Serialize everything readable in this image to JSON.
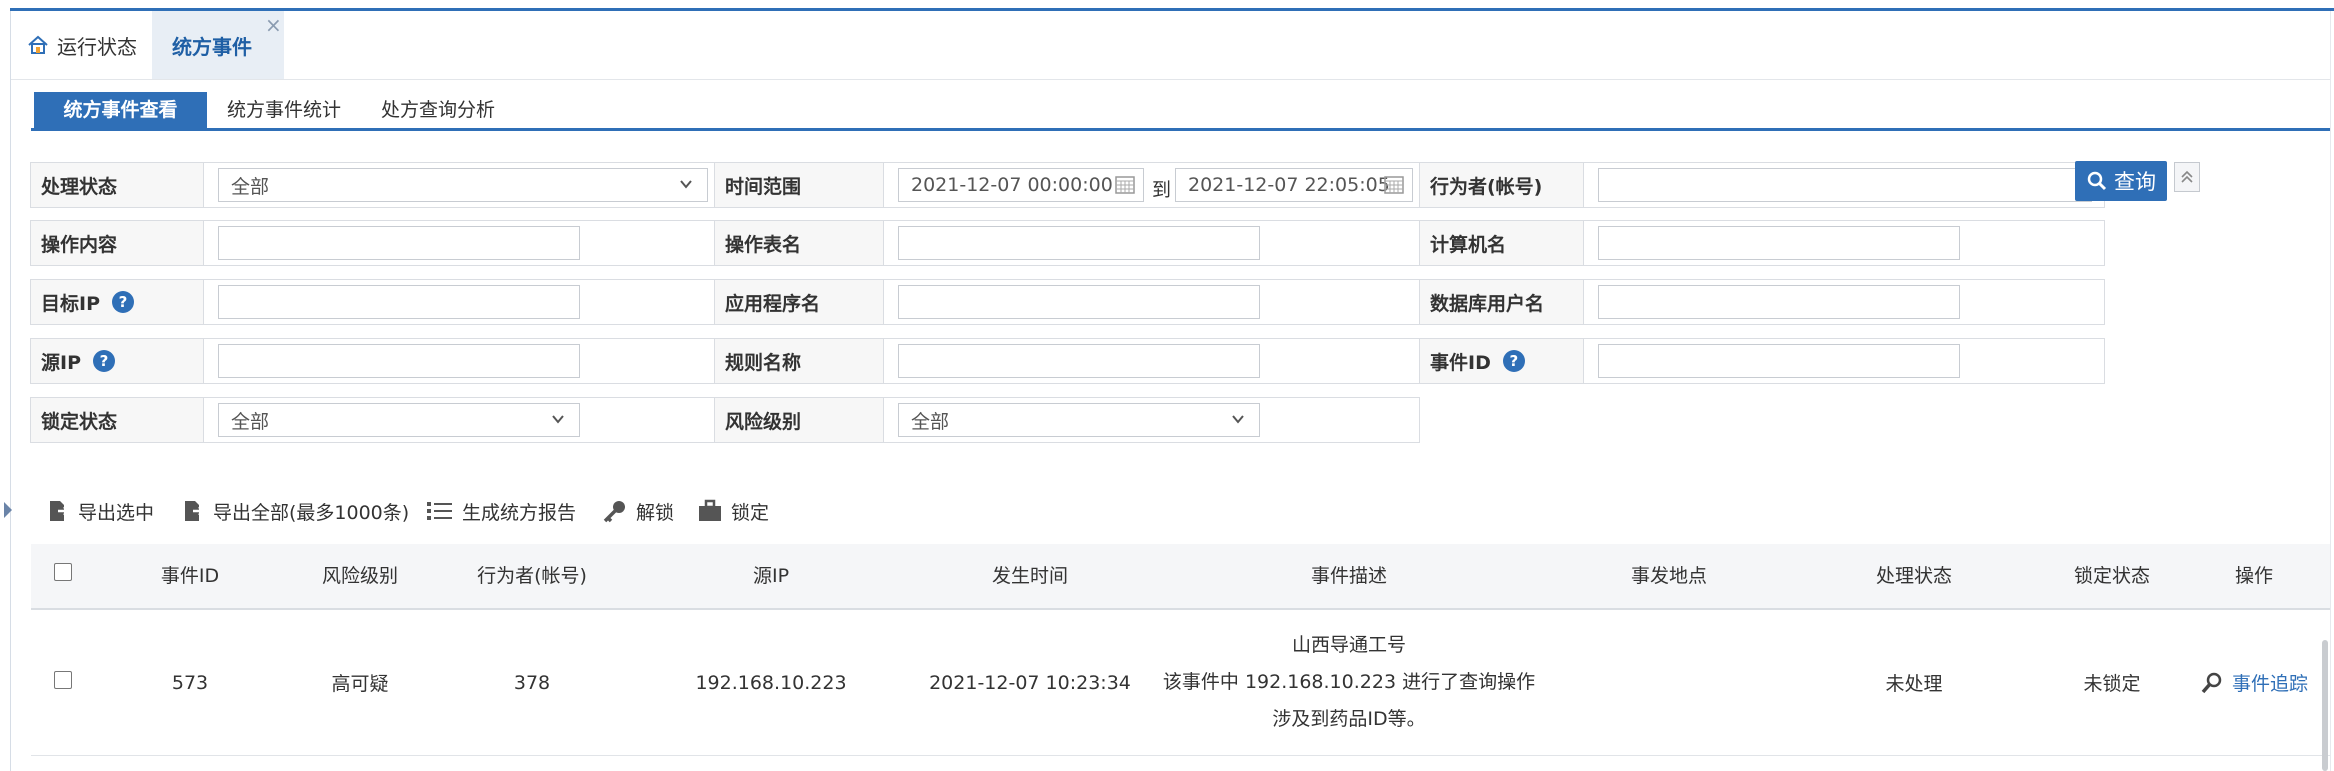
{
  "tabs": {
    "home_label": "运行状态",
    "active_label": "统方事件",
    "close_glyph": "×"
  },
  "subtabs": [
    "统方事件查看",
    "统方事件统计",
    "处方查询分析"
  ],
  "filters": {
    "status_label": "处理状态",
    "status_value": "全部",
    "time_label": "时间范围",
    "time_start": "2021-12-07 00:00:00",
    "time_to": "到",
    "time_end": "2021-12-07 22:05:05",
    "actor_label": "行为者(帐号)",
    "op_content_label": "操作内容",
    "op_table_label": "操作表名",
    "computer_label": "计算机名",
    "target_ip_label": "目标IP",
    "app_label": "应用程序名",
    "db_user_label": "数据库用户名",
    "source_ip_label": "源IP",
    "rule_label": "规则名称",
    "event_id_label": "事件ID",
    "lock_label": "锁定状态",
    "lock_value": "全部",
    "risk_label": "风险级别",
    "risk_value": "全部",
    "help_glyph": "?"
  },
  "query_button": "查询",
  "toolbar": {
    "export_selected": "导出选中",
    "export_all": "导出全部(最多1000条)",
    "report": "生成统方报告",
    "unlock": "解锁",
    "lock": "锁定"
  },
  "table": {
    "headers": [
      "事件ID",
      "风险级别",
      "行为者(帐号)",
      "源IP",
      "发生时间",
      "事件描述",
      "事发地点",
      "处理状态",
      "锁定状态",
      "操作"
    ],
    "rows": [
      {
        "event_id": "573",
        "risk": "高可疑",
        "actor": "378",
        "source_ip": "192.168.10.223",
        "time": "2021-12-07 10:23:34",
        "desc_line1": "山西导通工号",
        "desc_line2": "该事件中 192.168.10.223 进行了查询操作",
        "desc_line3": "涉及到药品ID等。",
        "location": "",
        "status": "未处理",
        "lock_status": "未锁定",
        "action": "事件追踪"
      }
    ]
  },
  "colors": {
    "accent": "#2f6fb7",
    "header_bg": "#f5f6f8"
  }
}
